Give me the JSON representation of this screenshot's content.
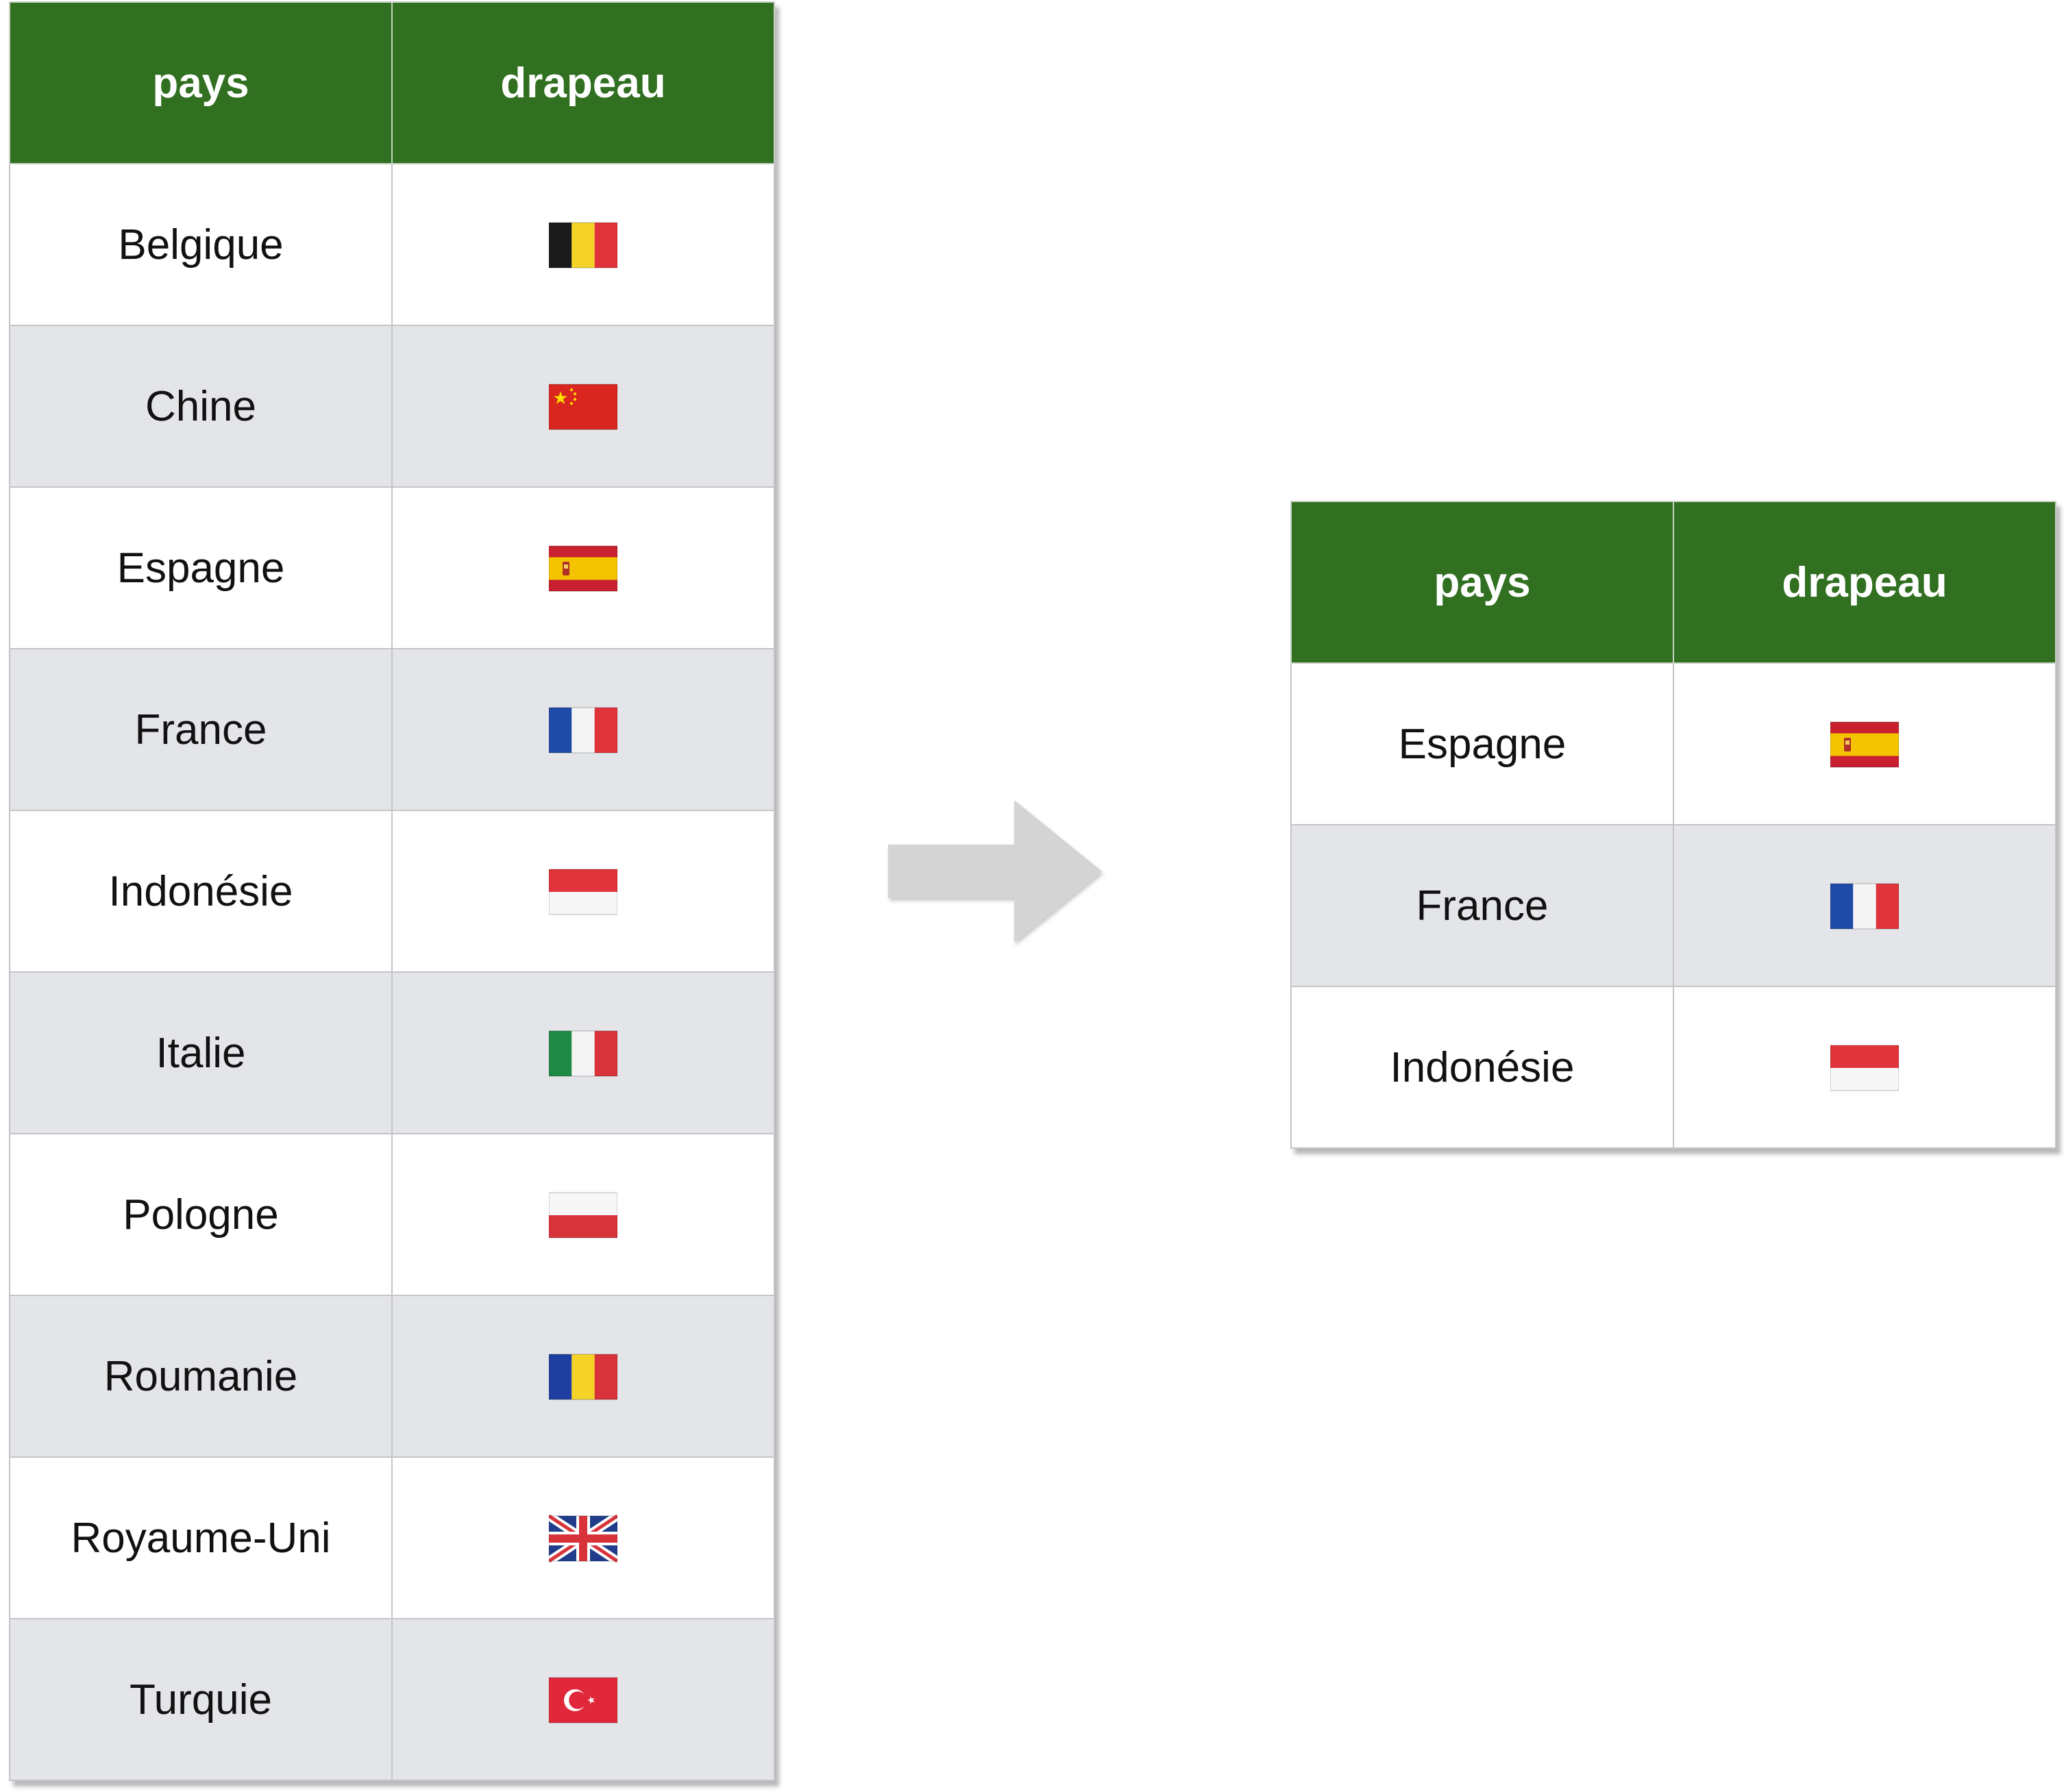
{
  "input_table": {
    "headers": [
      "pays",
      "drapeau"
    ],
    "rows": [
      {
        "pays": "Belgique",
        "flag": "belgium-flag-icon"
      },
      {
        "pays": "Chine",
        "flag": "china-flag-icon"
      },
      {
        "pays": "Espagne",
        "flag": "spain-flag-icon"
      },
      {
        "pays": "France",
        "flag": "france-flag-icon"
      },
      {
        "pays": "Indonésie",
        "flag": "indonesia-flag-icon"
      },
      {
        "pays": "Italie",
        "flag": "italy-flag-icon"
      },
      {
        "pays": "Pologne",
        "flag": "poland-flag-icon"
      },
      {
        "pays": "Roumanie",
        "flag": "romania-flag-icon"
      },
      {
        "pays": "Royaume-Uni",
        "flag": "uk-flag-icon"
      },
      {
        "pays": "Turquie",
        "flag": "turkey-flag-icon"
      }
    ]
  },
  "output_table": {
    "headers": [
      "pays",
      "drapeau"
    ],
    "rows": [
      {
        "pays": "Espagne",
        "flag": "spain-flag-icon"
      },
      {
        "pays": "France",
        "flag": "france-flag-icon"
      },
      {
        "pays": "Indonésie",
        "flag": "indonesia-flag-icon"
      }
    ]
  },
  "arrow_icon": "right-arrow-icon",
  "colors": {
    "header_bg": "#316f21",
    "header_text": "#ffffff",
    "row_alt_bg": "#e4e5e9",
    "arrow": "#d4d4d4"
  }
}
